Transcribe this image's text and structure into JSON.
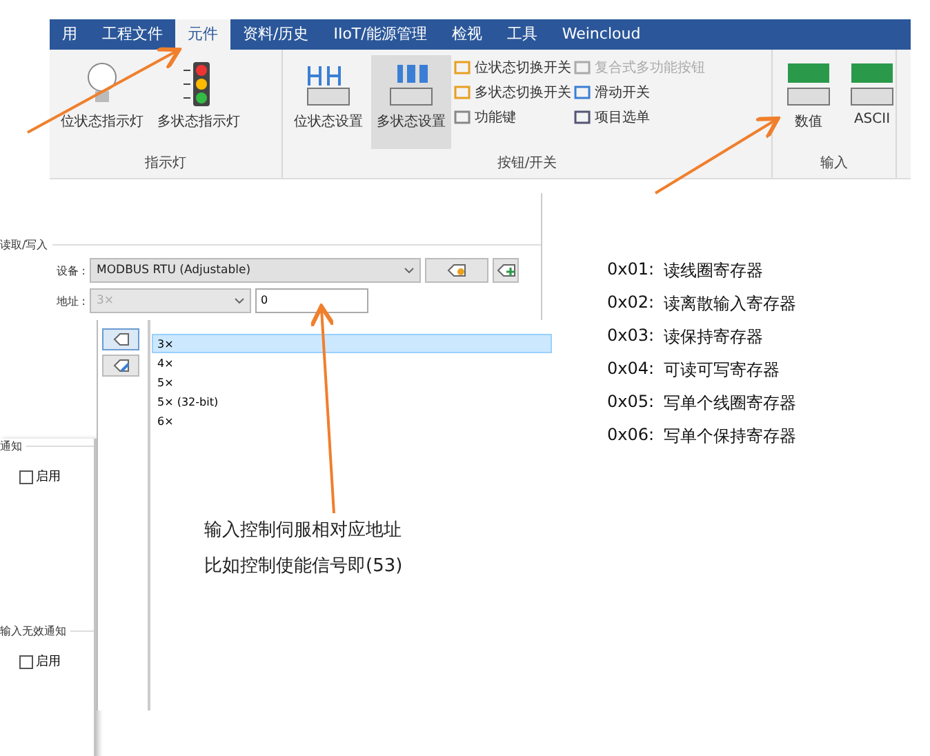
{
  "ribbon": {
    "tabs": [
      {
        "label": "用",
        "selected": false
      },
      {
        "label": "工程文件",
        "selected": false
      },
      {
        "label": "元件",
        "selected": true
      },
      {
        "label": "资料/历史",
        "selected": false
      },
      {
        "label": "IIoT/能源管理",
        "selected": false
      },
      {
        "label": "检视",
        "selected": false
      },
      {
        "label": "工具",
        "selected": false
      },
      {
        "label": "Weincloud",
        "selected": false
      }
    ],
    "groups": [
      {
        "label": "指示灯",
        "items": [
          {
            "kind": "large",
            "label": "位状态指示灯",
            "selected": false
          },
          {
            "kind": "large",
            "label": "多状态指示灯",
            "selected": false
          }
        ]
      },
      {
        "label": "按钮/开关",
        "items": [
          {
            "kind": "large",
            "label": "位状态设置",
            "selected": false
          },
          {
            "kind": "large",
            "label": "多状态设置",
            "selected": true
          },
          {
            "kind": "small",
            "label": "位状态切换开关",
            "selected": false,
            "disabled": false
          },
          {
            "kind": "small",
            "label": "多状态切换开关",
            "selected": false,
            "disabled": false
          },
          {
            "kind": "small",
            "label": "功能键",
            "selected": false,
            "disabled": false
          },
          {
            "kind": "small",
            "label": "复合式多功能按钮",
            "selected": false,
            "disabled": true
          },
          {
            "kind": "small",
            "label": "滑动开关",
            "selected": false,
            "disabled": false
          },
          {
            "kind": "small",
            "label": "项目选单",
            "selected": false,
            "disabled": false
          }
        ]
      },
      {
        "label": "输入",
        "items": [
          {
            "kind": "large",
            "label": "数值",
            "selected": false
          },
          {
            "kind": "large",
            "label": "ASCII",
            "selected": false
          }
        ]
      }
    ]
  },
  "dialog": {
    "section_title": "读取/写入",
    "device_label": "设备 :",
    "device_value": "MODBUS RTU (Adjustable)",
    "address_label": "地址 :",
    "address_type": "3×",
    "address_value": "0",
    "options": [
      {
        "label": "3×",
        "selected": true
      },
      {
        "label": "4×",
        "selected": false
      },
      {
        "label": "5×",
        "selected": false
      },
      {
        "label": "5× (32-bit)",
        "selected": false
      },
      {
        "label": "6×",
        "selected": false
      }
    ],
    "notifications": [
      {
        "title": "通知",
        "checkbox_label": "启用",
        "checked": false
      },
      {
        "title": "输入无效通知",
        "checkbox_label": "启用",
        "checked": false
      }
    ]
  },
  "annotation": [
    "输入控制伺服相对应地址",
    "比如控制使能信号即(53)"
  ],
  "notes": [
    {
      "code": "0x01:",
      "text": "读线圈寄存器"
    },
    {
      "code": "0x02:",
      "text": "读离散输入寄存器"
    },
    {
      "code": "0x03:",
      "text": "读保持寄存器"
    },
    {
      "code": "0x04:",
      "text": "可读可写寄存器"
    },
    {
      "code": "0x05:",
      "text": "写单个线圈寄存器"
    },
    {
      "code": "0x06:",
      "text": "写单个保持寄存器"
    }
  ]
}
